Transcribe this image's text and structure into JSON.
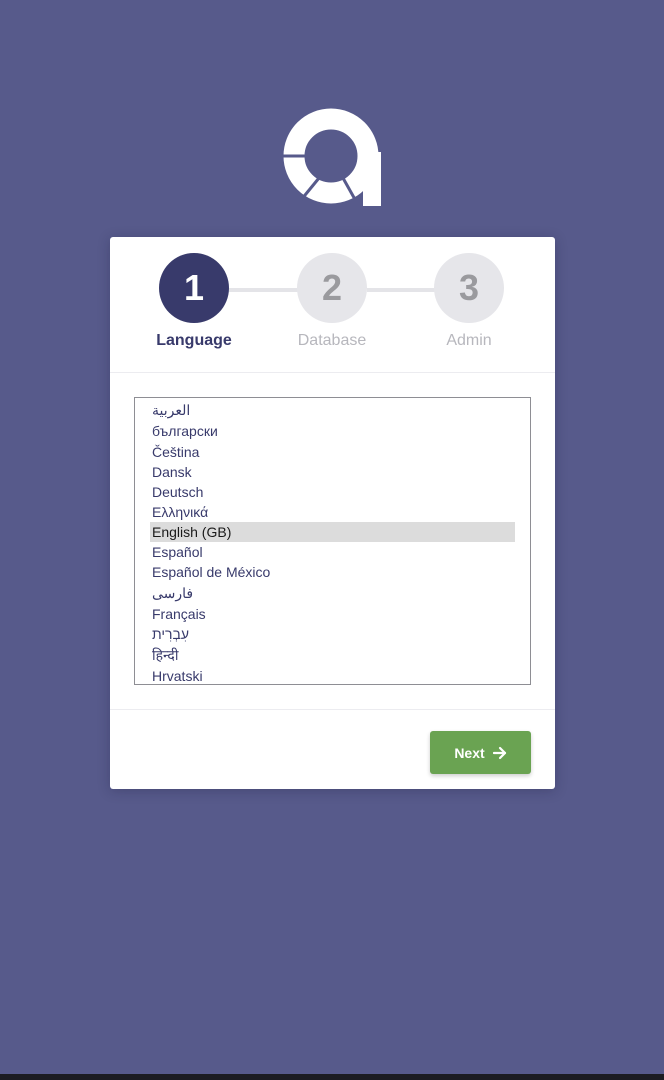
{
  "app": {
    "logo_icon": "app-logo",
    "background_color": "#575a8b"
  },
  "wizard": {
    "steps": [
      {
        "number": "1",
        "label": "Language",
        "state": "active"
      },
      {
        "number": "2",
        "label": "Database",
        "state": "inactive"
      },
      {
        "number": "3",
        "label": "Admin",
        "state": "inactive"
      }
    ],
    "active_color": "#383a6b"
  },
  "language_list": {
    "items": [
      "العربية",
      "български",
      "Čeština",
      "Dansk",
      "Deutsch",
      "Ελληνικά",
      "English (GB)",
      "Español",
      "Español de México",
      "فارسی",
      "Français",
      "עִבְרִית",
      "हिन्दी",
      "Hrvatski"
    ],
    "selected": "English (GB)"
  },
  "footer": {
    "next_label": "Next",
    "next_icon": "arrow-right-icon",
    "button_color": "#6aa352"
  }
}
